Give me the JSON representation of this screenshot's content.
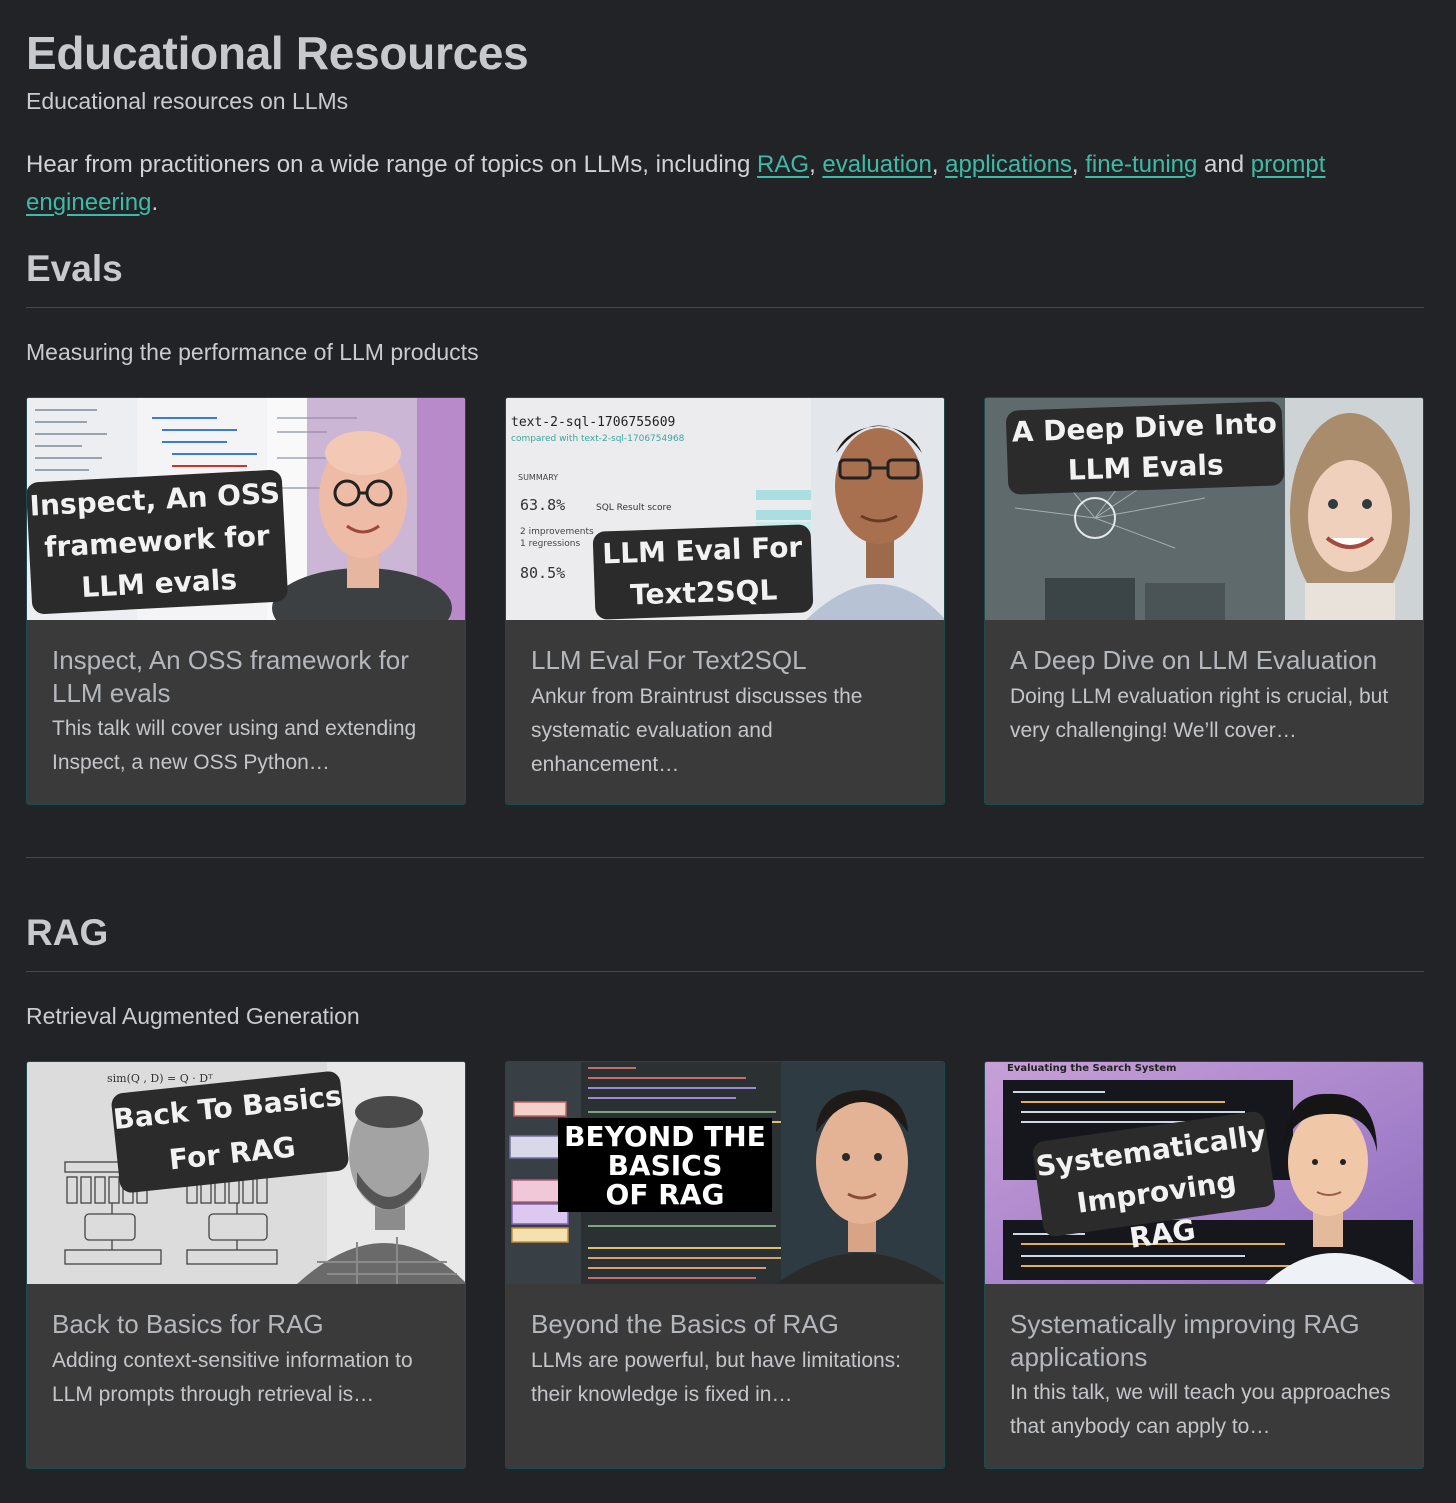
{
  "page": {
    "title": "Educational Resources",
    "subtitle": "Educational resources on LLMs",
    "intro": {
      "prefix": "Hear from practitioners on a wide range of topics on LLMs, including ",
      "link_rag": "RAG",
      "sep1": ", ",
      "link_evaluation": "evaluation",
      "sep2": ", ",
      "link_applications": "applications",
      "sep3": ", ",
      "link_finetuning": "fine-tuning",
      "and": " and ",
      "link_prompt": "prompt engineering",
      "end": "."
    }
  },
  "sections": [
    {
      "heading": "Evals",
      "description": "Measuring the performance of LLM products",
      "cards": [
        {
          "title": "Inspect, An OSS framework for LLM evals",
          "description": "This talk will cover using and extending Inspect, a new OSS Python…",
          "thumb_text": [
            "Inspect, An OSS",
            "framework  for",
            "LLM evals"
          ]
        },
        {
          "title": "LLM Eval For Text2SQL",
          "description": "Ankur from Braintrust discusses the systematic evaluation and enhancement…",
          "thumb_text": [
            "LLM Eval For",
            "Text2SQL"
          ],
          "thumb_header": "text-2-sql-1706755609",
          "thumb_compared": "compared with text-2-sql-1706754968",
          "thumb_summary": "SUMMARY",
          "thumb_score_1": "63.8%",
          "thumb_score_1_label": "SQL Result score",
          "thumb_score_2": "80.5%",
          "thumb_improvements": "2 improvements",
          "thumb_regressions": "1 regressions"
        },
        {
          "title": "A Deep Dive on LLM Evaluation",
          "description": "Doing LLM evaluation right is crucial, but very challenging! We’ll cover…",
          "thumb_text": [
            "A Deep Dive Into",
            "LLM Evals"
          ]
        }
      ]
    },
    {
      "heading": "RAG",
      "description": "Retrieval Augmented Generation",
      "cards": [
        {
          "title": "Back to Basics for RAG",
          "description": "Adding context-sensitive information to LLM prompts through retrieval is…",
          "thumb_text": [
            "Back To Basics",
            "For RAG"
          ],
          "thumb_formula": "sim(Q , D) = Q · Dᵀ"
        },
        {
          "title": "Beyond the Basics of RAG",
          "description": "LLMs are powerful, but have limitations: their knowledge is fixed in…",
          "thumb_text": [
            "BEYOND THE",
            "BASICS",
            "OF RAG"
          ]
        },
        {
          "title": "Systematically improving RAG applications",
          "description": "In this talk, we will teach you approaches that anybody can apply to…",
          "thumb_text": [
            "Systematically",
            "Improving RAG"
          ],
          "thumb_header": "Evaluating the Search System"
        }
      ]
    }
  ],
  "colors": {
    "background": "#222326",
    "card": "#3a3a3b",
    "link": "#3dbba6",
    "heading": "#c6cace"
  }
}
